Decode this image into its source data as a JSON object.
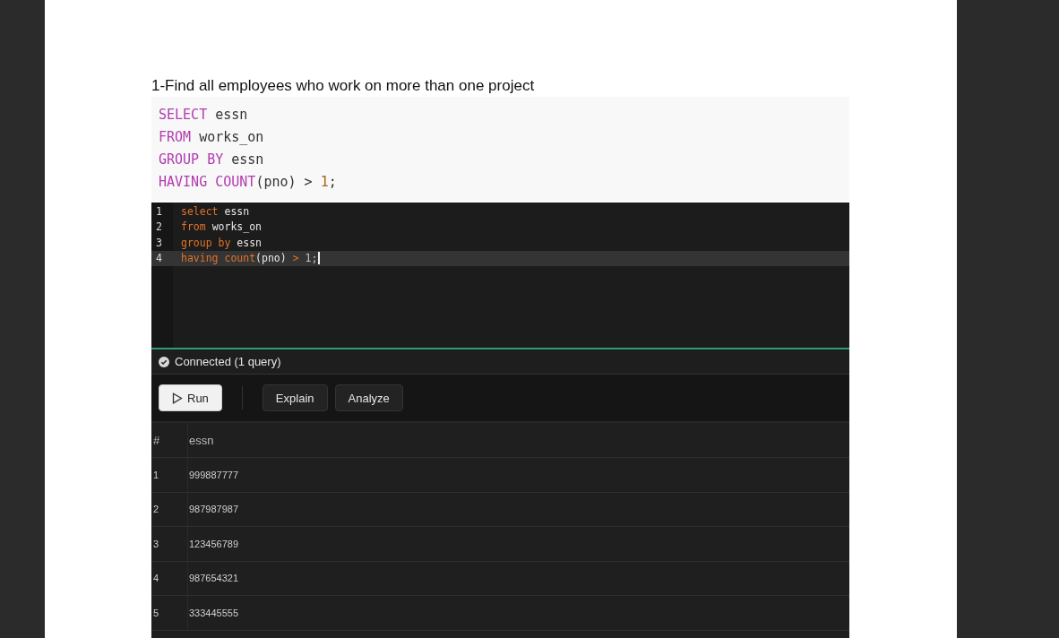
{
  "heading": "1-Find all employees who work on more than one project",
  "snippet": [
    [
      {
        "kind": "keyword",
        "text": "SELECT"
      },
      {
        "kind": "plain",
        "text": " essn"
      }
    ],
    [
      {
        "kind": "keyword",
        "text": "FROM"
      },
      {
        "kind": "plain",
        "text": " works_on"
      }
    ],
    [
      {
        "kind": "keyword",
        "text": "GROUP BY"
      },
      {
        "kind": "plain",
        "text": " essn"
      }
    ],
    [
      {
        "kind": "keyword",
        "text": "HAVING COUNT"
      },
      {
        "kind": "plain",
        "text": "(pno) > "
      },
      {
        "kind": "number",
        "text": "1"
      },
      {
        "kind": "plain",
        "text": ";"
      }
    ]
  ],
  "editor": {
    "lines": [
      {
        "number": "1",
        "active": false,
        "tokens": [
          {
            "kind": "keyword",
            "text": "select"
          },
          {
            "kind": "plain",
            "text": " essn"
          }
        ]
      },
      {
        "number": "2",
        "active": false,
        "tokens": [
          {
            "kind": "keyword",
            "text": "from"
          },
          {
            "kind": "plain",
            "text": " works_on"
          }
        ]
      },
      {
        "number": "3",
        "active": false,
        "tokens": [
          {
            "kind": "keyword",
            "text": "group by"
          },
          {
            "kind": "plain",
            "text": " essn"
          }
        ]
      },
      {
        "number": "4",
        "active": true,
        "tokens": [
          {
            "kind": "keyword",
            "text": "having count"
          },
          {
            "kind": "plain",
            "text": "(pno) "
          },
          {
            "kind": "operator",
            "text": ">"
          },
          {
            "kind": "number",
            "text": " 1;"
          }
        ]
      }
    ]
  },
  "status": "Connected (1 query)",
  "toolbar": [
    {
      "label": "Run",
      "kind": "primary"
    },
    {
      "label": "Explain",
      "kind": "secondary"
    },
    {
      "label": "Analyze",
      "kind": "secondary"
    }
  ],
  "table": {
    "columns": [
      "#",
      "essn"
    ],
    "rows": [
      [
        "1",
        "999887777"
      ],
      [
        "2",
        "987987987"
      ],
      [
        "3",
        "123456789"
      ],
      [
        "4",
        "987654321"
      ],
      [
        "5",
        "333445555"
      ]
    ]
  }
}
